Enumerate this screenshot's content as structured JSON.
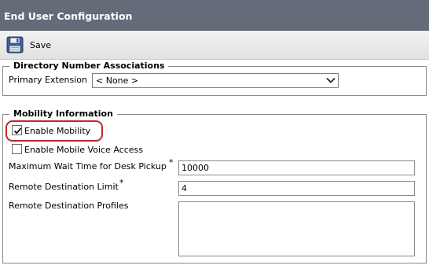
{
  "window": {
    "title": "End User Configuration"
  },
  "toolbar": {
    "save_label": "Save",
    "save_icon": "floppy-disk-icon"
  },
  "directory_number": {
    "legend": "Directory Number Associations",
    "primary_extension_label": "Primary Extension",
    "primary_extension_value": "< None >"
  },
  "mobility": {
    "legend": "Mobility Information",
    "enable_mobility_label": "Enable Mobility",
    "enable_mobility_checked": true,
    "enable_mobile_voice_label": "Enable Mobile Voice Access",
    "enable_mobile_voice_checked": false,
    "max_wait_label": "Maximum Wait Time for Desk Pickup",
    "max_wait_required": "*",
    "max_wait_value": "10000",
    "remote_dest_limit_label": "Remote Destination Limit",
    "remote_dest_limit_required": "*",
    "remote_dest_limit_value": "4",
    "remote_dest_profiles_label": "Remote Destination Profiles",
    "remote_dest_profiles_value": ""
  },
  "colors": {
    "title_bar": "#646c7a",
    "highlight": "#c0272d"
  }
}
